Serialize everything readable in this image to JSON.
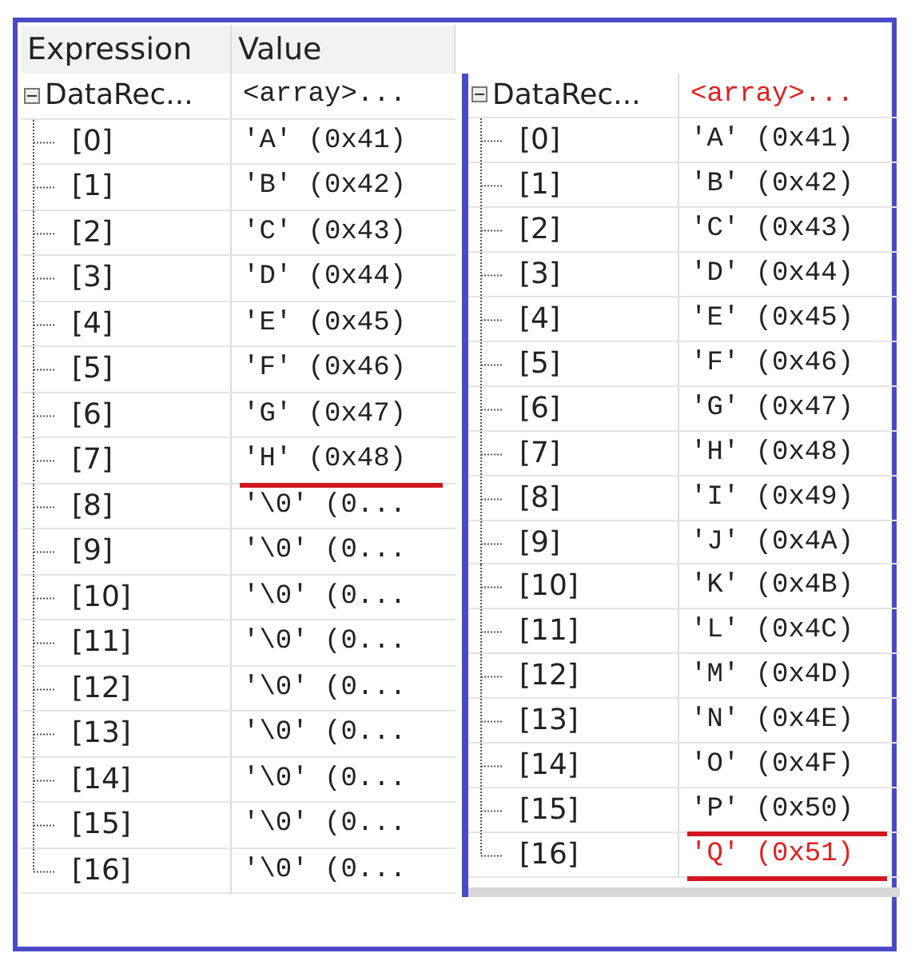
{
  "panels": [
    {
      "columns": [
        "Expression",
        "Value"
      ],
      "root": {
        "name": "DataRec...",
        "value": "<array>...",
        "changed": false,
        "expanded": true,
        "children": [
          {
            "name": "[0]",
            "value": "'A' (0x41)",
            "changed": false,
            "underlined": false
          },
          {
            "name": "[1]",
            "value": "'B' (0x42)",
            "changed": false,
            "underlined": false
          },
          {
            "name": "[2]",
            "value": "'C' (0x43)",
            "changed": false,
            "underlined": false
          },
          {
            "name": "[3]",
            "value": "'D' (0x44)",
            "changed": false,
            "underlined": false
          },
          {
            "name": "[4]",
            "value": "'E' (0x45)",
            "changed": false,
            "underlined": false
          },
          {
            "name": "[5]",
            "value": "'F' (0x46)",
            "changed": false,
            "underlined": false
          },
          {
            "name": "[6]",
            "value": "'G' (0x47)",
            "changed": false,
            "underlined": false
          },
          {
            "name": "[7]",
            "value": "'H' (0x48)",
            "changed": false,
            "underlined": true
          },
          {
            "name": "[8]",
            "value": "'\\0' (0...",
            "changed": false,
            "underlined": false
          },
          {
            "name": "[9]",
            "value": "'\\0' (0...",
            "changed": false,
            "underlined": false
          },
          {
            "name": "[10]",
            "value": "'\\0' (0...",
            "changed": false,
            "underlined": false
          },
          {
            "name": "[11]",
            "value": "'\\0' (0...",
            "changed": false,
            "underlined": false
          },
          {
            "name": "[12]",
            "value": "'\\0' (0...",
            "changed": false,
            "underlined": false
          },
          {
            "name": "[13]",
            "value": "'\\0' (0...",
            "changed": false,
            "underlined": false
          },
          {
            "name": "[14]",
            "value": "'\\0' (0...",
            "changed": false,
            "underlined": false
          },
          {
            "name": "[15]",
            "value": "'\\0' (0...",
            "changed": false,
            "underlined": false
          },
          {
            "name": "[16]",
            "value": "'\\0' (0...",
            "changed": false,
            "underlined": false
          }
        ]
      }
    },
    {
      "root": {
        "name": "DataRec...",
        "value": "<array>...",
        "changed": true,
        "expanded": true,
        "children": [
          {
            "name": "[0]",
            "value": "'A' (0x41)",
            "changed": false,
            "underlined": false
          },
          {
            "name": "[1]",
            "value": "'B' (0x42)",
            "changed": false,
            "underlined": false
          },
          {
            "name": "[2]",
            "value": "'C' (0x43)",
            "changed": false,
            "underlined": false
          },
          {
            "name": "[3]",
            "value": "'D' (0x44)",
            "changed": false,
            "underlined": false
          },
          {
            "name": "[4]",
            "value": "'E' (0x45)",
            "changed": false,
            "underlined": false
          },
          {
            "name": "[5]",
            "value": "'F' (0x46)",
            "changed": false,
            "underlined": false
          },
          {
            "name": "[6]",
            "value": "'G' (0x47)",
            "changed": false,
            "underlined": false
          },
          {
            "name": "[7]",
            "value": "'H' (0x48)",
            "changed": false,
            "underlined": false
          },
          {
            "name": "[8]",
            "value": "'I' (0x49)",
            "changed": false,
            "underlined": false
          },
          {
            "name": "[9]",
            "value": "'J' (0x4A)",
            "changed": false,
            "underlined": false
          },
          {
            "name": "[10]",
            "value": "'K' (0x4B)",
            "changed": false,
            "underlined": false
          },
          {
            "name": "[11]",
            "value": "'L' (0x4C)",
            "changed": false,
            "underlined": false
          },
          {
            "name": "[12]",
            "value": "'M' (0x4D)",
            "changed": false,
            "underlined": false
          },
          {
            "name": "[13]",
            "value": "'N' (0x4E)",
            "changed": false,
            "underlined": false
          },
          {
            "name": "[14]",
            "value": "'O' (0x4F)",
            "changed": false,
            "underlined": false
          },
          {
            "name": "[15]",
            "value": "'P' (0x50)",
            "changed": false,
            "underlined": true
          },
          {
            "name": "[16]",
            "value": "'Q' (0x51)",
            "changed": true,
            "underlined": true
          }
        ]
      }
    }
  ]
}
